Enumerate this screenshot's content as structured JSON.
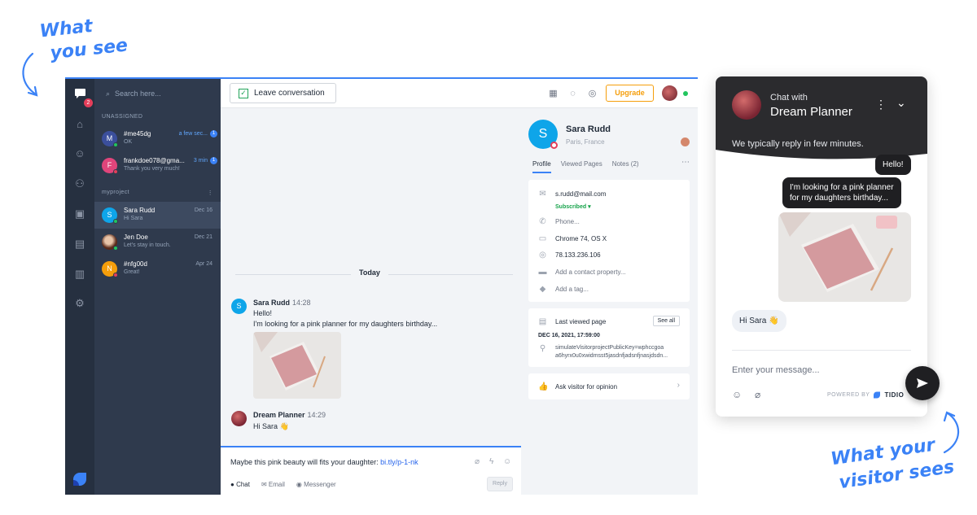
{
  "annotations": {
    "top_left": [
      "What",
      "you see"
    ],
    "bottom_right": [
      "What your",
      "visitor sees"
    ]
  },
  "rail": {
    "badge_count": "2"
  },
  "list": {
    "search_placeholder": "Search here...",
    "unassigned_label": "UNASSIGNED",
    "project_label": "myproject",
    "conversations": [
      {
        "initial": "M",
        "name": "#me45dg",
        "preview": "OK",
        "time": "a few sec...",
        "unread": "1",
        "color": "#3b4f9c",
        "status": "#22c55e"
      },
      {
        "initial": "F",
        "name": "frankdoe078@gma...",
        "preview": "Thank you very much!",
        "time": "3 min",
        "unread": "1",
        "color": "#e0457b",
        "status": "#e53e5a"
      },
      {
        "initial": "S",
        "name": "Sara Rudd",
        "preview": "Hi Sara",
        "time": "Dec 16",
        "color": "#0ea5e9",
        "status": "#22c55e"
      },
      {
        "initial": "",
        "name": "Jen Doe",
        "preview": "Let's stay in touch.",
        "time": "Dec 21",
        "color": "#6b3b2a",
        "status": "#22c55e"
      },
      {
        "initial": "N",
        "name": "#nfg00d",
        "preview": "Great!",
        "time": "Apr 24",
        "color": "#f59e0b",
        "status": "#e53e5a"
      }
    ]
  },
  "topbar": {
    "leave_label": "Leave conversation",
    "upgrade_label": "Upgrade"
  },
  "chat": {
    "day_label": "Today",
    "visitor": {
      "initial": "S",
      "name": "Sara Rudd",
      "time": "14:28",
      "lines": [
        "Hello!",
        "I'm looking for a pink planner for my daughters birthday..."
      ]
    },
    "agent": {
      "name": "Dream Planner",
      "time": "14:29",
      "line": "Hi Sara 👋"
    }
  },
  "composer": {
    "text": "Maybe this pink beauty will fits your daughter: ",
    "link": "bi.tly/p-1-nk",
    "tabs": [
      "Chat",
      "Email",
      "Messenger"
    ],
    "reply_label": "Reply"
  },
  "profile": {
    "initial": "S",
    "name": "Sara Rudd",
    "location": "Paris, France",
    "tabs": [
      "Profile",
      "Viewed Pages",
      "Notes (2)"
    ],
    "email": "s.rudd@mail.com",
    "subscribed": "Subscribed ▾",
    "phone": "Phone...",
    "browser": "Chrome 74, OS X",
    "ip": "78.133.236.106",
    "add_property": "Add a contact property...",
    "add_tag": "Add a tag...",
    "last_viewed_label": "Last viewed page",
    "see_all": "See all",
    "last_viewed_date": "DEC 16, 2021, 17:59:00",
    "last_viewed_url_1": "simulateVisitorprojectPublicKey=wphccgoa",
    "last_viewed_url_2": "a6hyrx0u0xwidmsst5jasdnfjadsnfjnasjdsdn...",
    "ask_label": "Ask visitor for opinion"
  },
  "widget": {
    "chat_with": "Chat with",
    "title": "Dream Planner",
    "reply_time": "We typically reply in few minutes.",
    "msg_hello": "Hello!",
    "msg_looking_1": "I'm looking for a pink planner",
    "msg_looking_2": "for my daughters birthday...",
    "msg_agent": "Hi Sara 👋",
    "input_placeholder": "Enter your message...",
    "powered_by": "POWERED BY",
    "brand": "TIDIO"
  },
  "colors": {
    "accent": "#3b82f6",
    "sidebar": "#2f3a4d",
    "rail": "#263040",
    "upgrade": "#f59e0b"
  }
}
